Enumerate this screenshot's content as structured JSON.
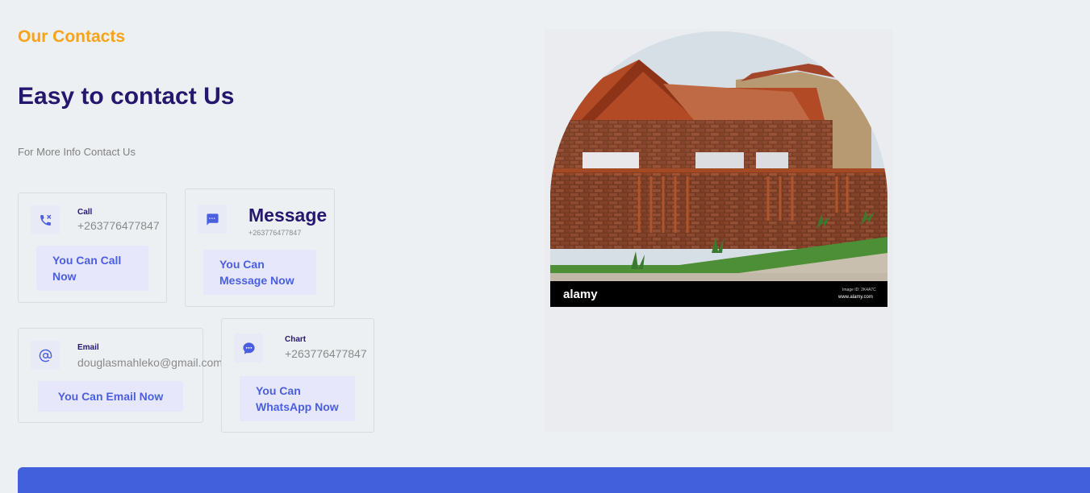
{
  "header": {
    "eyebrow": "Our Contacts",
    "title": "Easy to contact Us",
    "subtitle": "For More Info Contact Us"
  },
  "cards": {
    "call": {
      "label": "Call",
      "value": "+263776477847",
      "button": "You Can Call Now",
      "icon": "phone-icon"
    },
    "message": {
      "label": "Message",
      "value": "+263776477847",
      "button": "You Can Message Now",
      "icon": "message-icon"
    },
    "email": {
      "label": "Email",
      "value": "douglasmahleko@gmail.com",
      "button": "You Can Email Now",
      "icon": "at-icon"
    },
    "chat": {
      "label": "Chart",
      "value": "+263776477847",
      "button": "You Can WhatsApp Now",
      "icon": "chat-bubble-icon"
    }
  },
  "image": {
    "watermark_logo": "alamy",
    "watermark_id": "Image ID: 2K4A7C",
    "watermark_site": "www.alamy.com"
  },
  "colors": {
    "accent": "#f7a21a",
    "heading": "#25166e",
    "button_text": "#4a5ee0",
    "button_bg": "#e7e7fb",
    "footer_bar": "#4360dc"
  }
}
